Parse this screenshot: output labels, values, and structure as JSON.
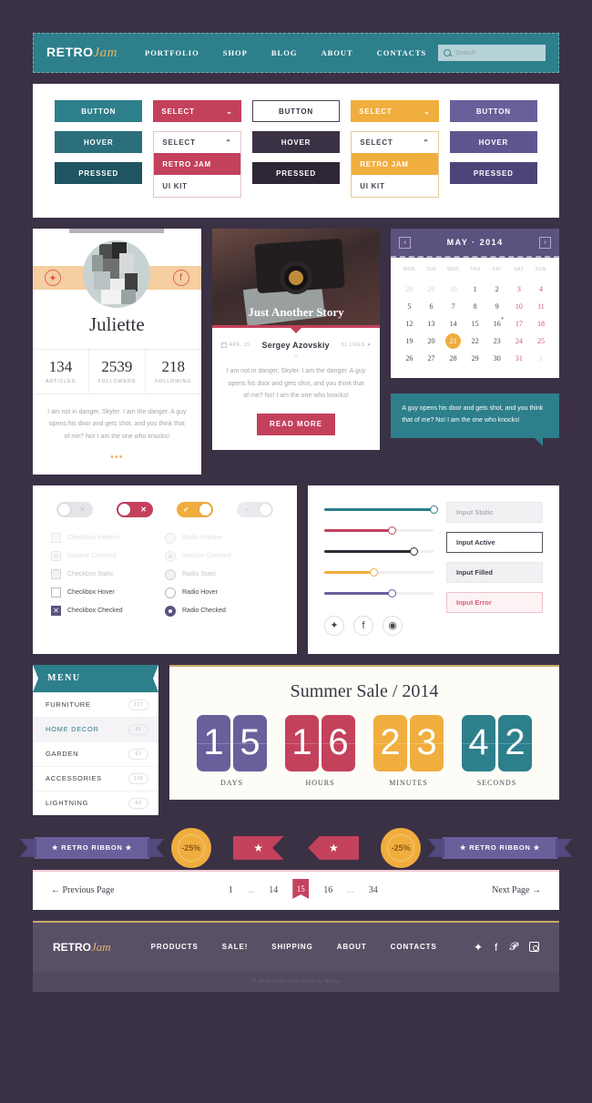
{
  "header": {
    "logo_main": "RETRO",
    "logo_accent": "Jam",
    "nav": [
      "PORTFOLIO",
      "SHOP",
      "BLOG",
      "ABOUT",
      "CONTACTS"
    ],
    "search_placeholder": "Search"
  },
  "buttons": {
    "columns": [
      {
        "type": "solid",
        "color": "#2d7f8c",
        "labels": [
          "BUTTON",
          "HOVER",
          "PRESSED"
        ],
        "colors": [
          "#2d7f8c",
          "#2c6f7c",
          "#1e5560"
        ]
      },
      {
        "type": "select",
        "color": "#c4415c",
        "label": "SELECT",
        "caret_closed": "⌄",
        "caret_open": "⌃",
        "options": [
          "RETRO JAM",
          "UI KIT"
        ],
        "active_option": "RETRO JAM"
      },
      {
        "type": "solid",
        "color": "#3b3145",
        "labels": [
          "BUTTON",
          "HOVER",
          "PRESSED"
        ],
        "colors": [
          "#ffffff",
          "#3b3145",
          "#2e2536"
        ]
      },
      {
        "type": "select",
        "color": "#f0ae3e",
        "label": "SELECT",
        "caret_closed": "⌄",
        "caret_open": "⌃",
        "options": [
          "RETRO JAM",
          "UI KIT"
        ],
        "active_option": "RETRO JAM"
      },
      {
        "type": "solid",
        "color": "#6a5f9b",
        "labels": [
          "BUTTON",
          "HOVER",
          "PRESSED"
        ],
        "colors": [
          "#6a5f9b",
          "#60558f",
          "#4e447a"
        ]
      }
    ]
  },
  "profile": {
    "name": "Juliette",
    "social_left": "twitter-icon",
    "social_right": "facebook-icon",
    "stats": [
      {
        "value": "134",
        "label": "ARTICLES"
      },
      {
        "value": "2539",
        "label": "FOLLOWERS"
      },
      {
        "value": "218",
        "label": "FOLLOWING"
      }
    ],
    "quote": "I am not in danger, Skyler. I am the danger. A guy opens his door and gets shot, and you think that of me? No! I am the one who knocks!",
    "more_dots": "•••"
  },
  "blog": {
    "title": "Just Another Story",
    "date": "APR, 15",
    "author": "Sergey Azovskiy",
    "likes": "51 LIKES",
    "separator": "•",
    "excerpt": "I am not in danger, Skyler. I am the danger. A guy opens his door and gets shot, and you think that of me? No! I am the one who knocks!",
    "read_more": "READ MORE"
  },
  "calendar": {
    "title": "MAY · 2014",
    "prev": "‹",
    "next": "›",
    "dow": [
      "MON",
      "TUE",
      "WED",
      "THU",
      "FRI",
      "SAT",
      "SUN"
    ],
    "days": [
      {
        "n": "28",
        "mute": true
      },
      {
        "n": "29",
        "mute": true
      },
      {
        "n": "30",
        "mute": true
      },
      {
        "n": "1"
      },
      {
        "n": "2"
      },
      {
        "n": "3",
        "weekend": true
      },
      {
        "n": "4",
        "weekend": true
      },
      {
        "n": "5"
      },
      {
        "n": "6"
      },
      {
        "n": "7"
      },
      {
        "n": "8"
      },
      {
        "n": "9"
      },
      {
        "n": "10",
        "weekend": true
      },
      {
        "n": "11",
        "weekend": true
      },
      {
        "n": "12"
      },
      {
        "n": "13"
      },
      {
        "n": "14"
      },
      {
        "n": "15"
      },
      {
        "n": "16",
        "dot": true
      },
      {
        "n": "17",
        "weekend": true
      },
      {
        "n": "18",
        "weekend": true
      },
      {
        "n": "19"
      },
      {
        "n": "20"
      },
      {
        "n": "21",
        "selected": true
      },
      {
        "n": "22"
      },
      {
        "n": "23"
      },
      {
        "n": "24",
        "weekend": true
      },
      {
        "n": "25",
        "weekend": true
      },
      {
        "n": "26"
      },
      {
        "n": "27"
      },
      {
        "n": "28"
      },
      {
        "n": "29"
      },
      {
        "n": "30"
      },
      {
        "n": "31",
        "weekend": true
      },
      {
        "n": "1",
        "weekend": true,
        "mute": true
      }
    ]
  },
  "tooltip": {
    "text": "A guy opens his door and gets shot, and you think that of me? No! I am the one who knocks!"
  },
  "toggles": [
    {
      "state": "off",
      "glyph": "✕",
      "color": "#e6e4e8"
    },
    {
      "state": "off-red",
      "glyph": "✕",
      "color": "#c4415c"
    },
    {
      "state": "on-amber",
      "glyph": "✓",
      "color": "#f0ae3e"
    },
    {
      "state": "on-pale",
      "glyph": "✓",
      "color": "#eceaee"
    }
  ],
  "checkboxes": [
    {
      "label": "Checkbox Inactive",
      "state": "inactive"
    },
    {
      "label": "Inactive Checked",
      "state": "inactive-checked"
    },
    {
      "label": "Checkbox Static",
      "state": "static"
    },
    {
      "label": "Checkbox Hover",
      "state": "hover"
    },
    {
      "label": "Checkbox Checked",
      "state": "checked"
    }
  ],
  "radios": [
    {
      "label": "Radio Inactive",
      "state": "inactive"
    },
    {
      "label": "Inactive Checked",
      "state": "inactive-checked"
    },
    {
      "label": "Radio Static",
      "state": "static"
    },
    {
      "label": "Radio Hover",
      "state": "hover"
    },
    {
      "label": "Radio Checked",
      "state": "checked"
    }
  ],
  "sliders": [
    {
      "color": "#2d7f8c",
      "percent": 100
    },
    {
      "color": "#c4415c",
      "percent": 62
    },
    {
      "color": "#2f2b36",
      "percent": 82
    },
    {
      "color": "#f0ae3e",
      "percent": 45
    },
    {
      "color": "#6a5f9b",
      "percent": 62
    }
  ],
  "social_circles": [
    "twitter-icon",
    "facebook-icon",
    "instagram-icon"
  ],
  "inputs": [
    {
      "value": "Input Static",
      "state": "static"
    },
    {
      "value": "Input Active",
      "state": "active"
    },
    {
      "value": "Input Filled",
      "state": "filled"
    },
    {
      "value": "Input Error",
      "state": "error"
    }
  ],
  "menu": {
    "title": "MENU",
    "items": [
      {
        "label": "FURNITURE",
        "count": "217",
        "active": false
      },
      {
        "label": "HOME DECOR",
        "count": "35",
        "active": true
      },
      {
        "label": "GARDEN",
        "count": "62",
        "active": false
      },
      {
        "label": "ACCESSORIES",
        "count": "126",
        "active": false
      },
      {
        "label": "LIGHTNING",
        "count": "63",
        "active": false
      }
    ]
  },
  "countdown": {
    "title": "Summer Sale / 2014",
    "groups": [
      {
        "label": "DAYS",
        "digits": [
          "1",
          "5"
        ],
        "color": "#6a5f9b"
      },
      {
        "label": "HOURS",
        "digits": [
          "1",
          "6"
        ],
        "color": "#c4415c"
      },
      {
        "label": "MINUTES",
        "digits": [
          "2",
          "3"
        ],
        "color": "#f0ae3e"
      },
      {
        "label": "SECONDS",
        "digits": [
          "4",
          "2"
        ],
        "color": "#2d7f8c"
      }
    ]
  },
  "ribbons": {
    "left_label": "★ RETRO RIBBON ★",
    "right_label": "★ RETRO RIBBON ★",
    "seal_left": "-25%",
    "seal_right": "-25%",
    "tag_left": "★",
    "tag_right": "★"
  },
  "pagination": {
    "prev": "← Previous Page",
    "next": "Next Page →",
    "pages": [
      "1",
      "...",
      "14",
      "15",
      "16",
      "...",
      "34"
    ],
    "current": "15"
  },
  "footer": {
    "logo_main": "RETRO",
    "logo_accent": "Jam",
    "links": [
      "PRODUCTS",
      "SALE!",
      "SHIPPING",
      "ABOUT",
      "CONTACTS"
    ],
    "socials": [
      "twitter-icon",
      "facebook-icon",
      "pinterest-icon",
      "instagram-icon"
    ],
    "copyright": "© 2014 Retro Jam UI Kit by Berns"
  }
}
